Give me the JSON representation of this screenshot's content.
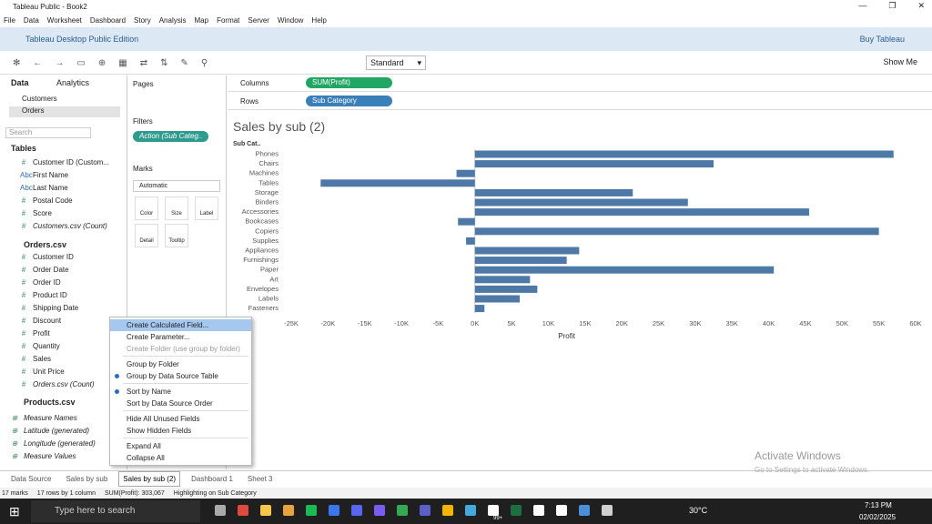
{
  "window": {
    "title": "Tableau Public - Book2"
  },
  "menu": [
    "File",
    "Data",
    "Worksheet",
    "Dashboard",
    "Story",
    "Analysis",
    "Map",
    "Format",
    "Server",
    "Window",
    "Help"
  ],
  "banner": {
    "title": "Tableau Desktop Public Edition",
    "buy": "Buy Tableau"
  },
  "toolbar": {
    "fit": "Standard",
    "show_me": "Show Me"
  },
  "data_pane": {
    "tab_data": "Data",
    "tab_analytics": "Analytics",
    "sources": [
      "Customers",
      "Orders"
    ],
    "search_placeholder": "Search",
    "tables_header": "Tables",
    "customers_fields": [
      "Customer ID (Custom...",
      "First Name",
      "Last Name",
      "Postal Code",
      "Score",
      "Customers.csv (Count)"
    ],
    "orders_header": "Orders.csv",
    "orders_fields": [
      "Customer ID",
      "Order Date",
      "Order ID",
      "Product ID",
      "Shipping Date",
      "Discount",
      "Profit",
      "Quantity",
      "Sales",
      "Unit Price",
      "Orders.csv (Count)"
    ],
    "products_header": "Products.csv",
    "extra_fields": [
      "Measure Names",
      "Latitude (generated)",
      "Longitude (generated)",
      "Measure Values"
    ]
  },
  "cards": {
    "pages": "Pages",
    "filters": "Filters",
    "filter_pill": "Action (Sub Categ..",
    "marks": "Marks",
    "marks_type": "Automatic",
    "mark_buttons": [
      "Color",
      "Size",
      "Label",
      "Detail",
      "Tooltip"
    ]
  },
  "shelves": {
    "columns_label": "Columns",
    "columns_pill": "SUM(Profit)",
    "rows_label": "Rows",
    "rows_pill": "Sub Category"
  },
  "view": {
    "title": "Sales by sub (2)",
    "row_header": "Sub Cat..",
    "xlabel": "Profit"
  },
  "chart_data": {
    "type": "bar",
    "orientation": "horizontal",
    "color": "#4e79a7",
    "categories": [
      "Phones",
      "Chairs",
      "Machines",
      "Tables",
      "Storage",
      "Binders",
      "Accessories",
      "Bookcases",
      "Copiers",
      "Supplies",
      "Appliances",
      "Furnishings",
      "Paper",
      "Art",
      "Envelopes",
      "Labels",
      "Fasteners"
    ],
    "values": [
      57000,
      32500,
      -2500,
      -21000,
      21500,
      29000,
      45500,
      -2300,
      55000,
      -1200,
      14200,
      12500,
      40700,
      7500,
      8500,
      6100,
      1300
    ],
    "xlim": [
      -25000,
      60000
    ],
    "ticks": [
      "-25K",
      "-20K",
      "-15K",
      "-10K",
      "-5K",
      "0K",
      "5K",
      "10K",
      "15K",
      "20K",
      "25K",
      "30K",
      "35K",
      "40K",
      "45K",
      "50K",
      "55K",
      "60K"
    ],
    "xlabel": "Profit"
  },
  "context_menu": {
    "items": [
      {
        "label": "Create Calculated Field...",
        "state": "highlight"
      },
      {
        "label": "Create Parameter...",
        "state": "normal"
      },
      {
        "label": "Create Folder (use group by folder)",
        "state": "disabled"
      },
      {
        "label": "Group by Folder",
        "state": "normal"
      },
      {
        "label": "Group by Data Source Table",
        "state": "checked"
      },
      {
        "label": "Sort by Name",
        "state": "checked"
      },
      {
        "label": "Sort by Data Source Order",
        "state": "normal"
      },
      {
        "label": "Hide All Unused Fields",
        "state": "normal"
      },
      {
        "label": "Show Hidden Fields",
        "state": "normal"
      },
      {
        "label": "Expand All",
        "state": "normal"
      },
      {
        "label": "Collapse All",
        "state": "normal"
      }
    ]
  },
  "sheet_tabs": [
    "Data Source",
    "Sales by sub",
    "Sales by sub (2)",
    "Dashboard 1",
    "Sheet 3"
  ],
  "status": [
    "17 marks",
    "17 rows by 1 column",
    "SUM(Profit): 303,067",
    "Highlighting on Sub Category"
  ],
  "watermark": {
    "title": "Activate Windows",
    "sub": "Go to Settings to activate Windows."
  },
  "taskbar": {
    "search": "Type here to search",
    "weather": "30°C",
    "time": "7:13 PM",
    "date": "02/02/2025",
    "badge": "99+"
  }
}
